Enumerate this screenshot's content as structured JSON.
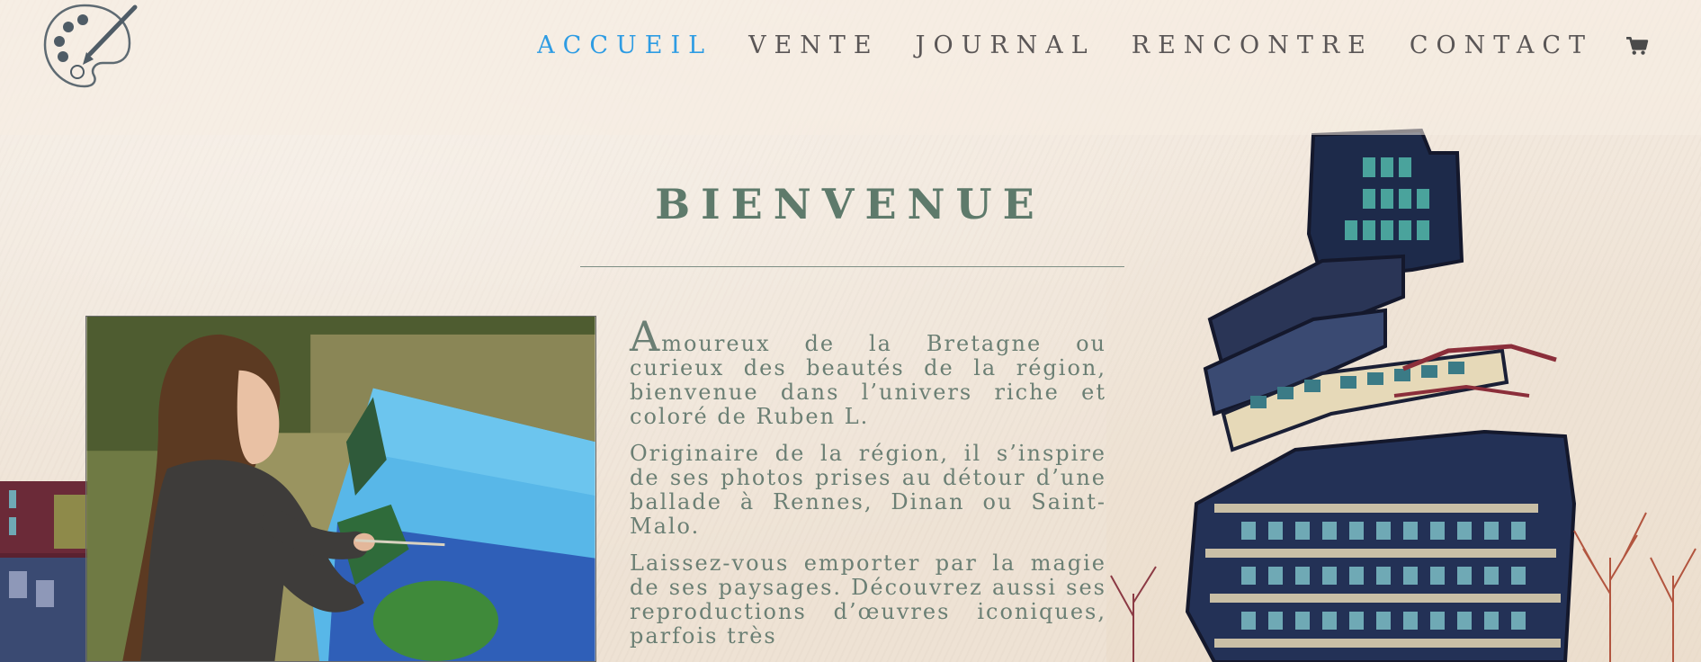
{
  "header": {
    "logo": "palette-brush-logo",
    "nav": [
      {
        "label": "ACCUEIL",
        "active": true
      },
      {
        "label": "VENTE",
        "active": false
      },
      {
        "label": "JOURNAL",
        "active": false
      },
      {
        "label": "RENCONTRE",
        "active": false
      },
      {
        "label": "CONTACT",
        "active": false
      }
    ],
    "cart_icon": "cart-icon"
  },
  "hero": {
    "title": "BIENVENUE"
  },
  "intro": {
    "dropcap": "A",
    "paragraph1": "moureux de la Bretagne ou curieux des beautés de la région, bienvenue dans l’univers riche et coloré de Ruben L.",
    "paragraph2": "Originaire de la région, il s’inspire de ses photos prises au détour d’une ballade à Rennes, Dinan ou Saint-Malo.",
    "paragraph3": "Laissez-vous emporter par la magie de ses paysages. Découvrez aussi ses reproductions d’œuvres iconiques, parfois très"
  },
  "colors": {
    "accent": "#2e9ce3",
    "nav_text": "#5a5656",
    "title": "#5e7a6b",
    "body_text": "#6b7f74",
    "background": "#f2e8de"
  }
}
